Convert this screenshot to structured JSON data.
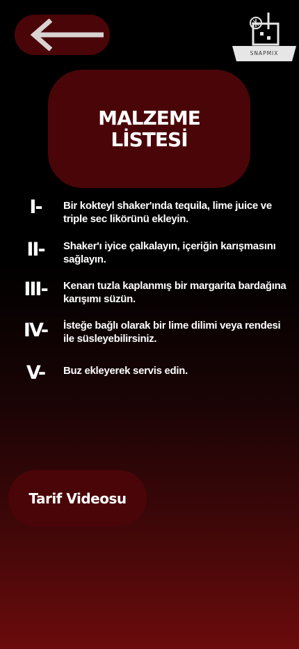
{
  "header": {
    "back_icon": "arrow-left-icon",
    "logo": {
      "text": "SNAPMIX",
      "icon": "cocktail-glass-icon"
    }
  },
  "title": {
    "text": "MALZEME LİSTESİ"
  },
  "steps": [
    {
      "num": "I-",
      "text": "Bir kokteyl shaker'ında tequila, lime juice ve triple sec likörünü ekleyin."
    },
    {
      "num": "II-",
      "text": "Shaker'ı iyice çalkalayın, içeriğin karışmasını sağlayın."
    },
    {
      "num": "III-",
      "text": "Kenarı tuzla kaplanmış bir margarita bardağına karışımı süzün."
    },
    {
      "num": "IV-",
      "text": "İsteğe bağlı olarak bir lime dilimi veya rendesi ile süsleyebilirsiniz."
    },
    {
      "num": "V-",
      "text": "Buz ekleyerek servis edin."
    }
  ],
  "video_button": {
    "label": "Tarif Videosu"
  },
  "colors": {
    "card": "#4a0508",
    "background_top": "#000000",
    "background_bottom": "#6b0b0c",
    "arrow": "#d9d2d2"
  }
}
